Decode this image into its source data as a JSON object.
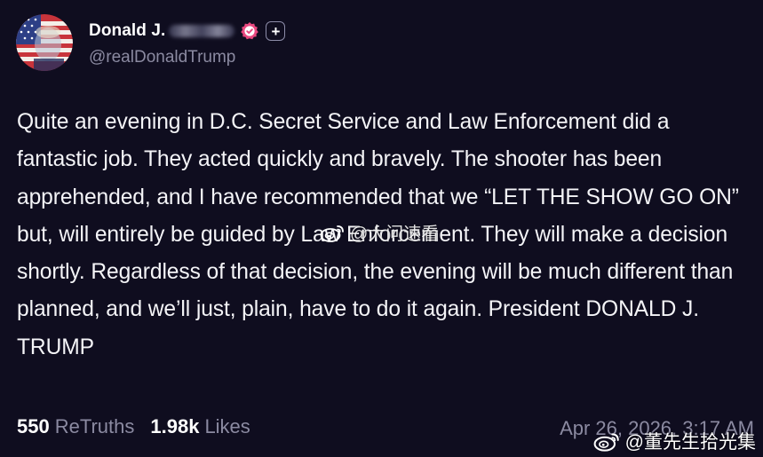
{
  "post": {
    "author": {
      "display_name": "Donald J.",
      "handle": "@realDonaldTrump",
      "verified_icon": "verified-badge-icon",
      "follow_icon": "plus-icon"
    },
    "text": "Quite an evening in D.C. Secret Service and Law Enforcement did a fantastic job. They acted quickly and bravely. The shooter has been apprehended, and I have recommended that we “LET THE SHOW GO ON” but, will entirely be guided by Law Enforcement. They will make a decision shortly. Regardless of that decision, the evening will be much different than planned, and we’ll just, plain, have to do it again. President DONALD J. TRUMP",
    "stats": {
      "retruths_count": "550",
      "retruths_label": "ReTruths",
      "likes_count": "1.98k",
      "likes_label": "Likes"
    },
    "timestamp": "Apr 26, 2026, 3:17 AM"
  },
  "watermarks": {
    "center": "@大问速看",
    "corner": "@董先生拾光集"
  },
  "colors": {
    "background": "#0f0d1f",
    "text": "#f4f4f7",
    "muted": "#8b8aa1",
    "verified_badge": "#e8487f"
  }
}
